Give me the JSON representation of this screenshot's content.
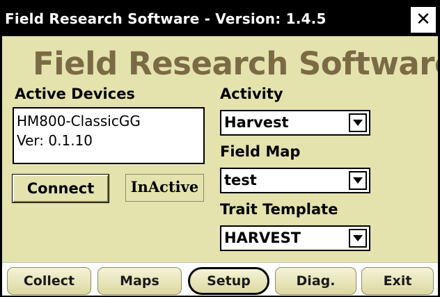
{
  "window": {
    "title": "Field Research Software - Version: 1.4.5",
    "close_label": "✕"
  },
  "banner": {
    "text": "Field Research Software"
  },
  "devices": {
    "label": "Active Devices",
    "lines": [
      "HM800-ClassicGG",
      "Ver: 0.1.10"
    ],
    "connect_label": "Connect",
    "status": "InActive"
  },
  "activity": {
    "label": "Activity",
    "value": "Harvest"
  },
  "field_map": {
    "label": "Field Map",
    "value": "test"
  },
  "trait_template": {
    "label": "Trait Template",
    "value": "HARVEST"
  },
  "tabs": [
    {
      "label": "Collect"
    },
    {
      "label": "Maps"
    },
    {
      "label": "Setup",
      "active": true
    },
    {
      "label": "Diag."
    },
    {
      "label": "Exit"
    }
  ],
  "colors": {
    "panel": "#e4e2ad",
    "banner_text": "#7a6b45",
    "titlebar": "#000000"
  }
}
